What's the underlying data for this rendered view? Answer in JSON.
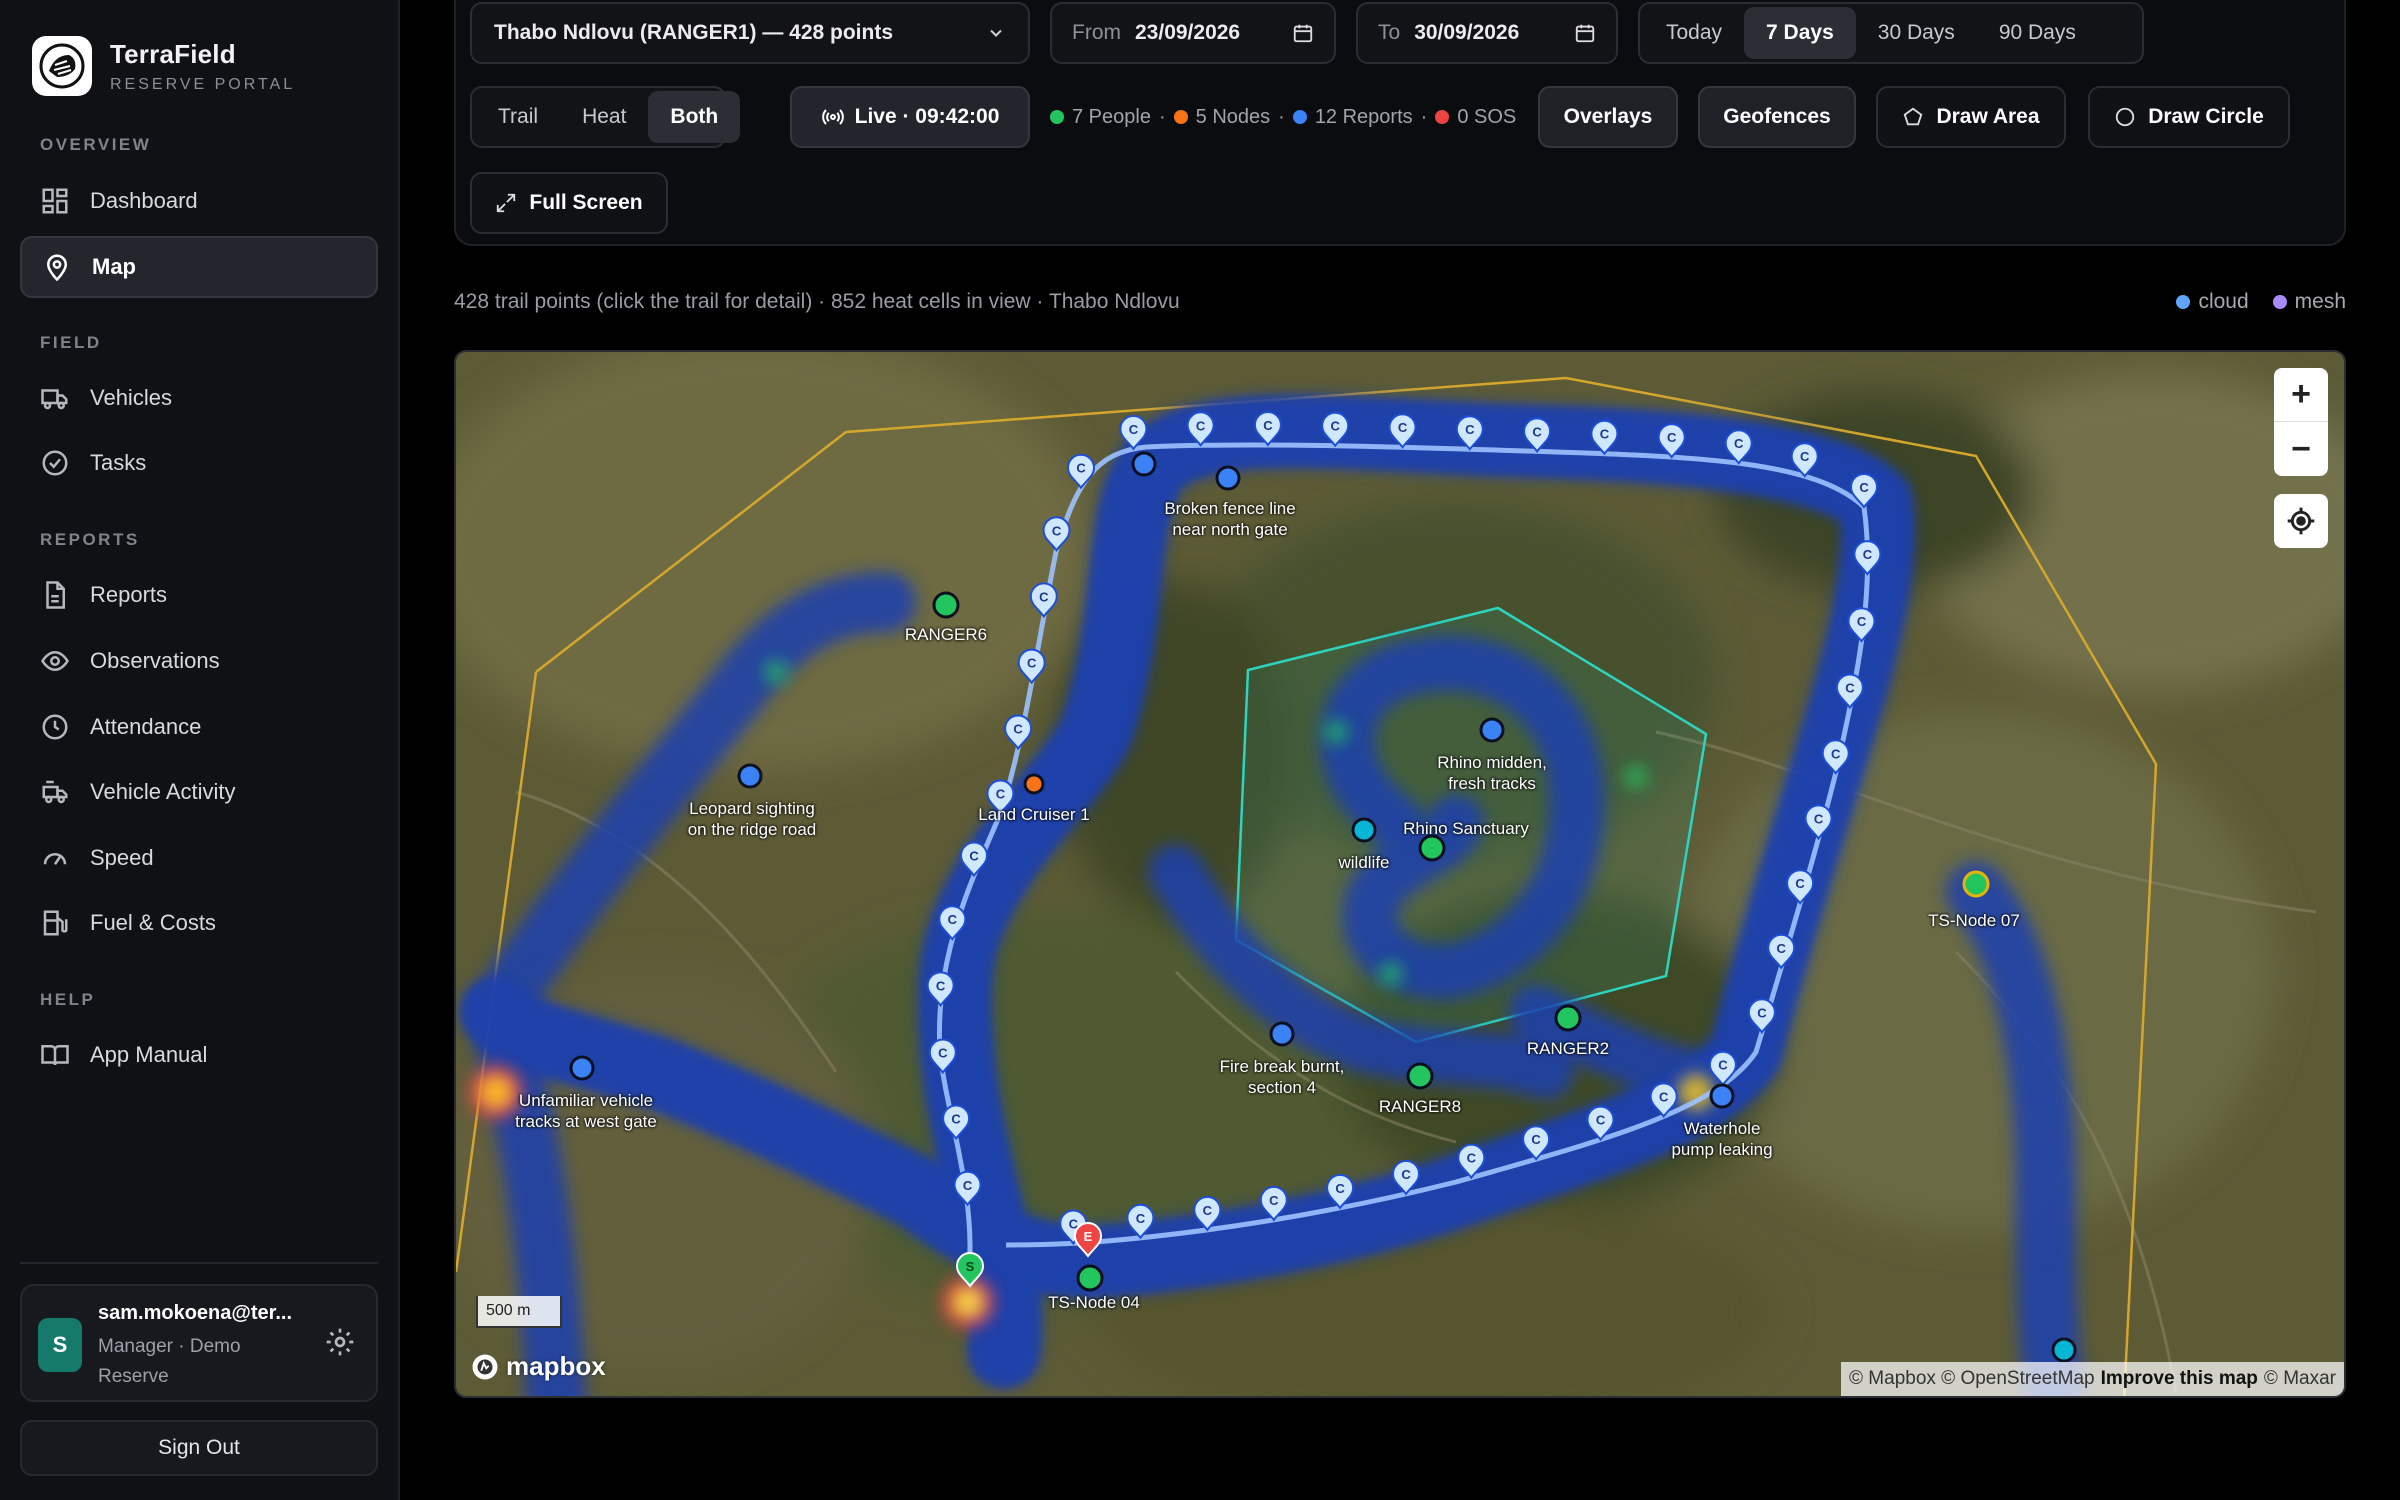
{
  "brand": {
    "name": "TerraField",
    "subtitle": "RESERVE PORTAL"
  },
  "nav": {
    "overview_label": "OVERVIEW",
    "dashboard": "Dashboard",
    "map": "Map",
    "field_label": "FIELD",
    "vehicles": "Vehicles",
    "tasks": "Tasks",
    "reports_label": "REPORTS",
    "reports": "Reports",
    "observations": "Observations",
    "attendance": "Attendance",
    "vehicle_activity": "Vehicle Activity",
    "speed": "Speed",
    "fuel": "Fuel & Costs",
    "help_label": "HELP",
    "manual": "App Manual"
  },
  "user": {
    "initial": "S",
    "email": "sam.mokoena@ter...",
    "role": "Manager · Demo Reserve",
    "sign_out": "Sign Out"
  },
  "controls": {
    "ranger_select": "Thabo Ndlovu (RANGER1) — 428 points",
    "from_label": "From",
    "from_value": "23/09/2026",
    "to_label": "To",
    "to_value": "30/09/2026",
    "ranges": [
      "Today",
      "7 Days",
      "30 Days",
      "90 Days"
    ],
    "active_range": "7 Days",
    "modes": [
      "Trail",
      "Heat",
      "Both"
    ],
    "active_mode": "Both",
    "live": "Live · 09:42:00",
    "stats": {
      "people": "7 People",
      "nodes": "5 Nodes",
      "reports": "12 Reports",
      "sos": "0 SOS",
      "sep": "·"
    },
    "overlays": "Overlays",
    "geofences": "Geofences",
    "draw_area": "Draw Area",
    "draw_circle": "Draw Circle",
    "full_screen": "Full Screen"
  },
  "info": {
    "summary": "428 trail points (click the trail for detail) · 852 heat cells in view · Thabo Ndlovu",
    "legend_cloud": "cloud",
    "legend_mesh": "mesh"
  },
  "colors": {
    "people": "#22c55e",
    "nodes": "#f97316",
    "reports": "#3b82f6",
    "sos": "#ef4444",
    "cloud": "#60a5fa",
    "mesh": "#a78bfa",
    "geofence_outer": "#d4a72c",
    "geofence_inner": "#2dd4bf"
  },
  "map": {
    "zoom_in": "+",
    "zoom_out": "−",
    "scale": "500 m",
    "logo": "mapbox",
    "attribution": {
      "mapbox": "© Mapbox",
      "osm": "© OpenStreetMap",
      "improve": "Improve this map",
      "maxar": "© Maxar"
    },
    "trail_marker_letter": "C",
    "start_letter": "S",
    "end_letter": "E",
    "labels": {
      "broken_fence": "Broken fence line\nnear north gate",
      "ranger6": "RANGER6",
      "leopard": "Leopard sighting\non the ridge road",
      "land_cruiser": "Land Cruiser 1",
      "rhino_midden": "Rhino midden,\nfresh tracks",
      "rhino_sanctuary": "Rhino Sanctuary",
      "wildlife": "wildlife",
      "ts_node07": "TS-Node 07",
      "ranger2": "RANGER2",
      "fire_break": "Fire break burnt,\nsection 4",
      "ranger8": "RANGER8",
      "waterhole": "Waterhole\npump leaking",
      "unfamiliar": "Unfamiliar vehicle\ntracks at west gate",
      "ts_node04": "TS-Node 04"
    }
  }
}
